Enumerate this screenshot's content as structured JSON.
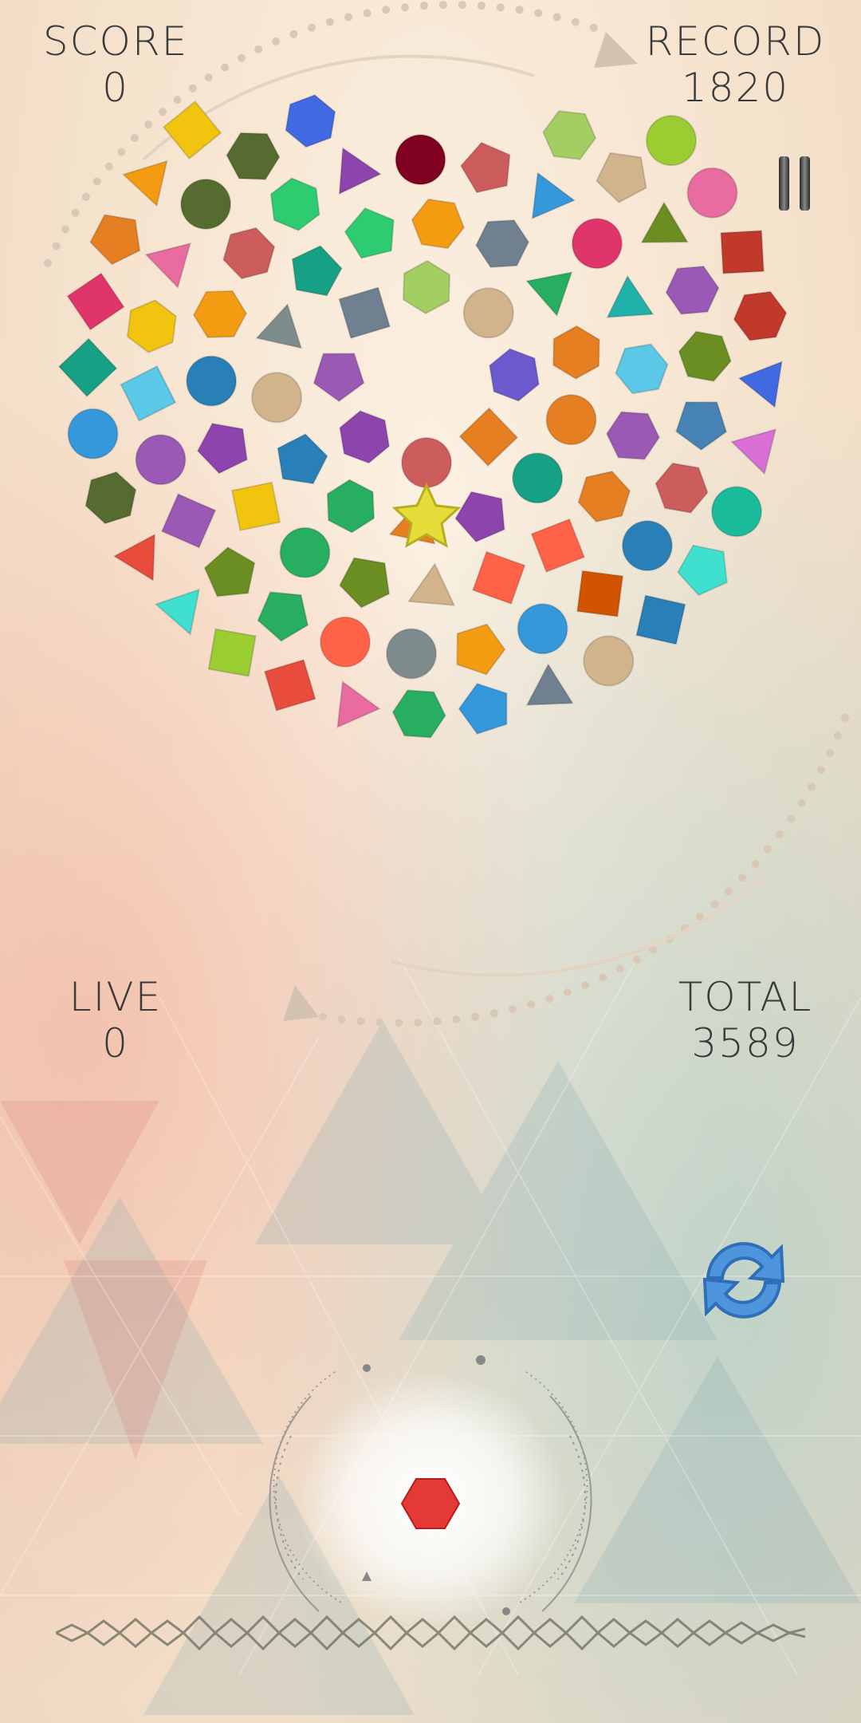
{
  "hud": {
    "score_label": "SCORE",
    "score_value": "0",
    "record_label": "RECORD",
    "record_value": "1820",
    "live_label": "LIVE",
    "live_value": "0",
    "total_label": "TOTAL",
    "total_value": "3589"
  },
  "icons": {
    "pause": "pause-icon",
    "refresh": "refresh-icon",
    "center": "star-icon"
  },
  "colors": {
    "text": "#3a3a3a",
    "refresh_blue": "#3f87d6",
    "next_piece": "#e53935",
    "star": "#e6dc3a"
  },
  "next_piece": {
    "shape": "hexagon",
    "color": "#e53935"
  },
  "center_piece": {
    "shape": "star",
    "color": "#e6dc3a"
  }
}
